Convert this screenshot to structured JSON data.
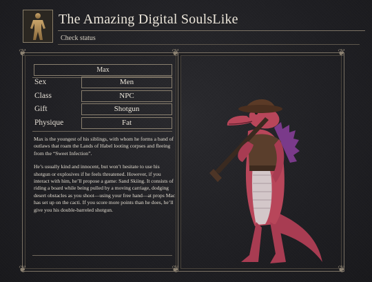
{
  "header": {
    "title": "The Amazing Digital SoulsLike",
    "subtitle": "Check status"
  },
  "character": {
    "name": "Max",
    "stats": [
      {
        "label": "Sex",
        "value": "Men"
      },
      {
        "label": "Class",
        "value": "NPC"
      },
      {
        "label": "Gift",
        "value": "Shotgun"
      },
      {
        "label": "Physique",
        "value": "Fat"
      }
    ],
    "description": [
      "Max is the youngest of his siblings, with whom he forms a band of outlaws that roam the Lands of Habel looting corpses and fleeing from the “Sweet Infection”.",
      "He’s usually kind and innocent, but won’t hesitate to use his shotgun or explosives if he feels threatened. However, if you interact with him, he’ll propose a game: Sand Skiing. It consists of riding a board while being pulled by a moving carriage, dodging desert obstacles as you shoot—using your free hand—at props Mac has set up on the cacti. If you score more points than he does, he’ll give you his double-barreled shotgun."
    ]
  },
  "colors": {
    "background": "#1f1f23",
    "frame_border": "#7b7265",
    "text": "#e6e0d6",
    "creature_skin": "#b8465a",
    "creature_spikes": "#7a3a8a"
  },
  "icons": {
    "portrait": "body-silhouette-icon",
    "corner_ornament": "flourish-ornament"
  }
}
